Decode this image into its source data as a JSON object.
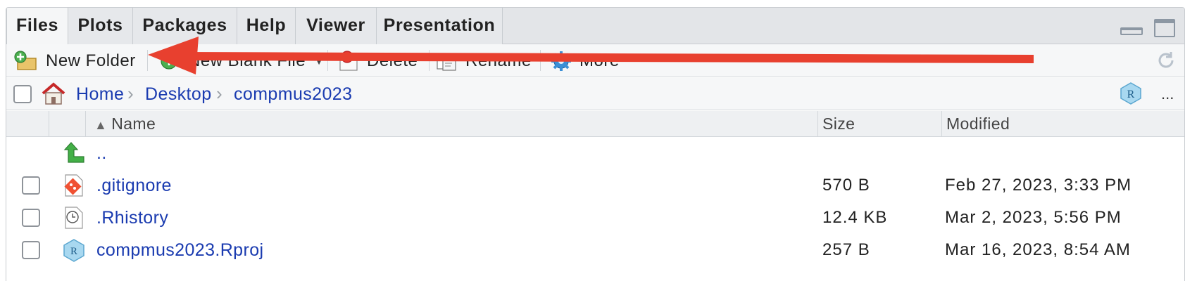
{
  "tabs": [
    {
      "label": "Files",
      "active": true
    },
    {
      "label": "Plots",
      "active": false
    },
    {
      "label": "Packages",
      "active": false
    },
    {
      "label": "Help",
      "active": false
    },
    {
      "label": "Viewer",
      "active": false
    },
    {
      "label": "Presentation",
      "active": false
    }
  ],
  "toolbar": {
    "new_folder": "New Folder",
    "new_blank_file": "New Blank File",
    "delete": "Delete",
    "rename": "Rename",
    "more": "More"
  },
  "breadcrumb": [
    "Home",
    "Desktop",
    "compmus2023"
  ],
  "breadcrumb_more": "...",
  "columns": {
    "name": "Name",
    "size": "Size",
    "modified": "Modified"
  },
  "parent_link": "..",
  "files": [
    {
      "name": ".gitignore",
      "size": "570 B",
      "modified": "Feb 27, 2023, 3:33 PM",
      "icon": "git-file-icon"
    },
    {
      "name": ".Rhistory",
      "size": "12.4 KB",
      "modified": "Mar 2, 2023, 5:56 PM",
      "icon": "history-file-icon"
    },
    {
      "name": "compmus2023.Rproj",
      "size": "257 B",
      "modified": "Mar 16, 2023, 8:54 AM",
      "icon": "rproj-file-icon"
    }
  ],
  "colors": {
    "link": "#1a3bb0",
    "annotation_arrow": "#e8402f",
    "tab_bg": "#e3e5e8"
  }
}
